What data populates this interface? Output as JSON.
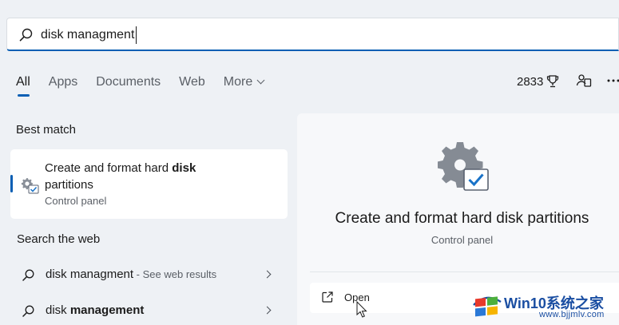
{
  "search": {
    "value": "disk managment",
    "icon": "search-icon"
  },
  "tabs": [
    {
      "label": "All",
      "active": true
    },
    {
      "label": "Apps"
    },
    {
      "label": "Documents"
    },
    {
      "label": "Web"
    },
    {
      "label": "More"
    }
  ],
  "header_right": {
    "points": "2833",
    "points_icon": "trophy-icon",
    "people_icon": "people-icon",
    "more_icon": "ellipsis-icon"
  },
  "best_match": {
    "heading": "Best match",
    "title_plain": "Create and format hard ",
    "title_bold": "disk",
    "title_line2": "partitions",
    "subtitle": "Control panel",
    "icon": "settings-check-icon"
  },
  "search_web": {
    "heading": "Search the web",
    "items": [
      {
        "term": "disk managment",
        "hint": " - See web results"
      },
      {
        "term_plain": "disk ",
        "term_bold": "management"
      }
    ]
  },
  "detail": {
    "title": "Create and format hard disk partitions",
    "subtitle": "Control panel",
    "open_label": "Open"
  },
  "watermark": {
    "brand": "Win10",
    "brand_cn": "系统之家",
    "url": "www.bjjmlv.com"
  },
  "colors": {
    "accent": "#0a5fb4",
    "background": "#eef1f5",
    "panel": "#f7f8fa",
    "watermark_blue": "#1a4ea2"
  }
}
